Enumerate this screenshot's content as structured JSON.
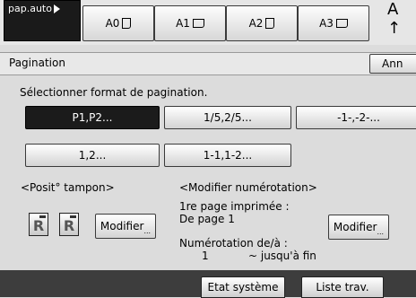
{
  "top": {
    "paper_auto": "pap.auto",
    "trays": [
      {
        "label": "A0",
        "icon": "portrait"
      },
      {
        "label": "A1",
        "icon": "landscape"
      },
      {
        "label": "A2",
        "icon": "portrait"
      },
      {
        "label": "A3",
        "icon": "landscape"
      }
    ],
    "cut_text": "A ↑"
  },
  "header": {
    "title": "Pagination",
    "cancel_label": "Ann"
  },
  "instruction": "Sélectionner format de pagination.",
  "formats": [
    {
      "label": "P1,P2...",
      "selected": true
    },
    {
      "label": "1/5,2/5...",
      "selected": false
    },
    {
      "label": "-1-,-2-...",
      "selected": false
    },
    {
      "label": "1,2...",
      "selected": false
    },
    {
      "label": "1-1,1-2...",
      "selected": false
    }
  ],
  "stamp_position": {
    "label": "<Posit° tampon>",
    "modify_label": "Modifier"
  },
  "renumber": {
    "label": "<Modifier numérotation>",
    "first_page_label": "1re page imprimée :",
    "first_page_value": "De page 1",
    "numbering_label": "Numérotation de/à :",
    "numbering_from": "1",
    "numbering_to": "~ jusqu'à fin",
    "modify_label": "Modifier"
  },
  "footer": {
    "system_status": "Etat système",
    "job_list": "Liste trav."
  },
  "colors": {
    "selected_bg": "#1b1b1b",
    "footer_bg": "#3d3d3d"
  }
}
